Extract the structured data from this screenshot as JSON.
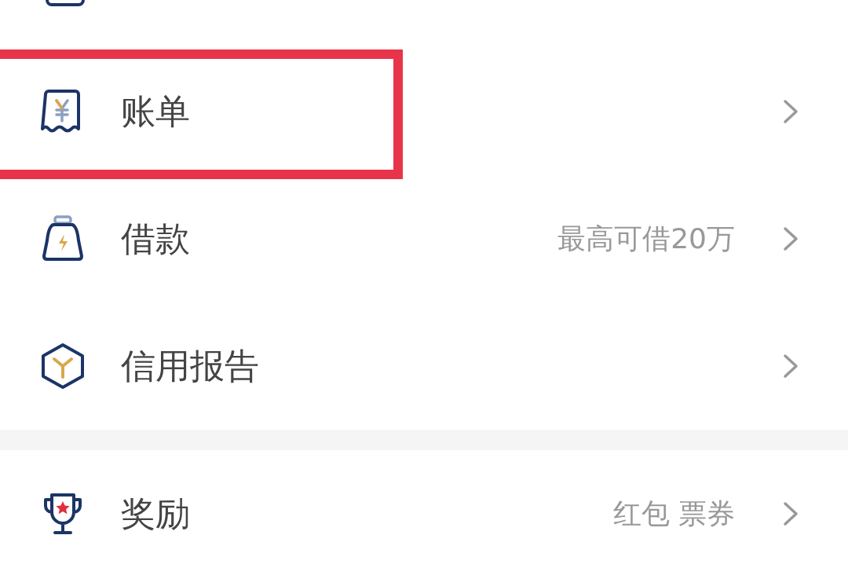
{
  "sections": [
    {
      "items": [
        {
          "kind": "bill",
          "label": "账单",
          "highlighted": true
        },
        {
          "kind": "loan",
          "label": "借款",
          "detail": "最高可借20万",
          "highlighted": false
        },
        {
          "kind": "credit",
          "label": "信用报告",
          "highlighted": false
        }
      ]
    },
    {
      "items": [
        {
          "kind": "reward",
          "label": "奖励",
          "detail": "红包 票券",
          "highlighted": false
        }
      ]
    }
  ]
}
